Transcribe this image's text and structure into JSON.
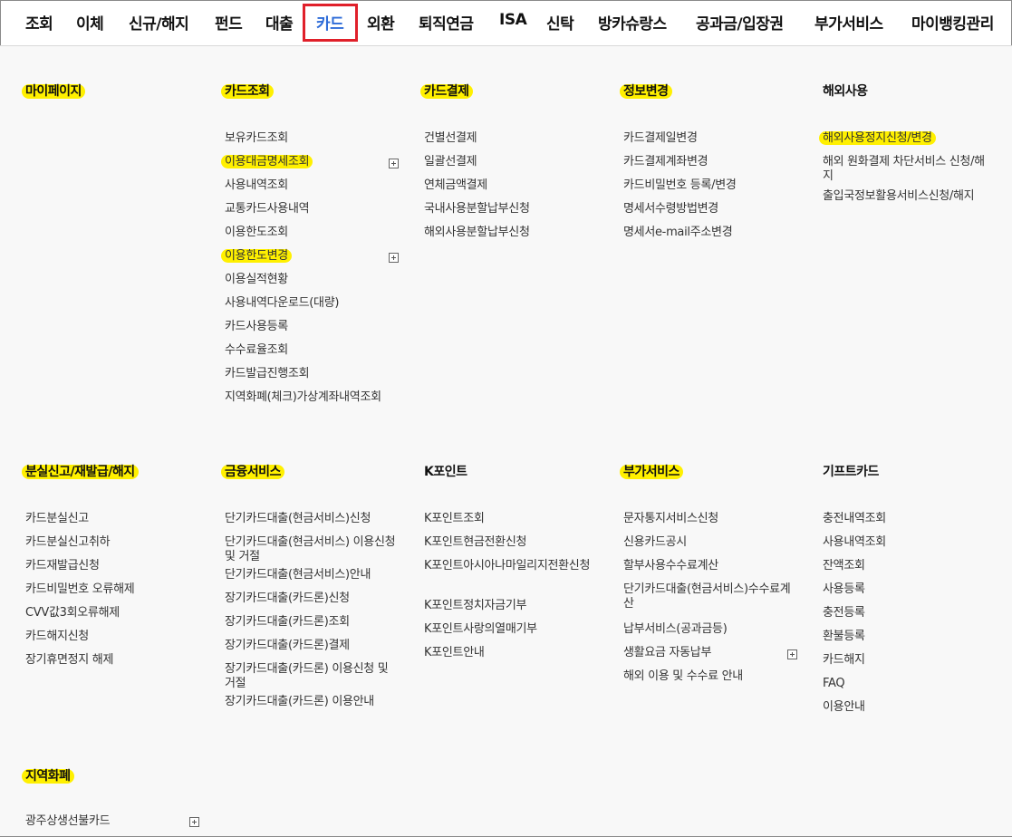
{
  "nav": {
    "items": [
      "조회",
      "이체",
      "신규/해지",
      "펀드",
      "대출",
      "카드",
      "외환",
      "퇴직연금",
      "ISA",
      "신탁",
      "방카슈랑스",
      "공과금/입장권",
      "부가서비스",
      "마이뱅킹관리"
    ],
    "active_index": 5
  },
  "menu": {
    "mypage": {
      "title": "마이페이지"
    },
    "card_inquiry": {
      "title": "카드조회",
      "items": [
        "보유카드조회",
        "이용대금명세조회",
        "사용내역조회",
        "교통카드사용내역",
        "이용한도조회",
        "이용한도변경",
        "이용실적현황",
        "사용내역다운로드(대량)",
        "카드사용등록",
        "수수료율조회",
        "카드발급진행조회",
        "지역화폐(체크)가상계좌내역조회"
      ]
    },
    "card_payment": {
      "title": "카드결제",
      "items": [
        "건별선결제",
        "일괄선결제",
        "연체금액결제",
        "국내사용분할납부신청",
        "해외사용분할납부신청"
      ]
    },
    "info_change": {
      "title": "정보변경",
      "items": [
        "카드결제일변경",
        "카드결제계좌변경",
        "카드비밀번호 등록/변경",
        "명세서수령방법변경",
        "명세서e-mail주소변경"
      ]
    },
    "overseas": {
      "title": "해외사용",
      "items": [
        "해외사용정지신청/변경",
        "해외 원화결제 차단서비스 신청/해지",
        "출입국정보활용서비스신청/해지"
      ]
    },
    "lost": {
      "title": "분실신고/재발급/해지",
      "items": [
        "카드분실신고",
        "카드분실신고취하",
        "카드재발급신청",
        "카드비밀번호 오류해제",
        "CVV값3회오류해제",
        "카드해지신청",
        "장기휴면정지 해제"
      ]
    },
    "finance": {
      "title": "금융서비스",
      "items": [
        "단기카드대출(현금서비스)신청",
        "단기카드대출(현금서비스) 이용신청 및 거절",
        "단기카드대출(현금서비스)안내",
        "장기카드대출(카드론)신청",
        "장기카드대출(카드론)조회",
        "장기카드대출(카드론)결제",
        "장기카드대출(카드론) 이용신청 및 거절",
        "장기카드대출(카드론) 이용안내"
      ]
    },
    "kpoint": {
      "title": "K포인트",
      "items": [
        "K포인트조회",
        "K포인트현금전환신청",
        "K포인트아시아나마일리지전환신청",
        "K포인트정치자금기부",
        "K포인트사랑의열매기부",
        "K포인트안내"
      ]
    },
    "addon": {
      "title": "부가서비스",
      "items": [
        "문자통지서비스신청",
        "신용카드공시",
        "할부사용수수료계산",
        "단기카드대출(현금서비스)수수료계산",
        "납부서비스(공과금등)",
        "생활요금 자동납부",
        "해외 이용 및 수수료 안내"
      ]
    },
    "gift": {
      "title": "기프트카드",
      "items": [
        "충전내역조회",
        "사용내역조회",
        "잔액조회",
        "사용등록",
        "충전등록",
        "환불등록",
        "카드해지",
        "FAQ",
        "이용안내"
      ]
    },
    "local": {
      "title": "지역화폐",
      "items": [
        "광주상생선불카드"
      ]
    }
  },
  "colors": {
    "highlight": "#fff000",
    "active_nav": "#2d6bd8",
    "active_box": "#e0202a"
  }
}
